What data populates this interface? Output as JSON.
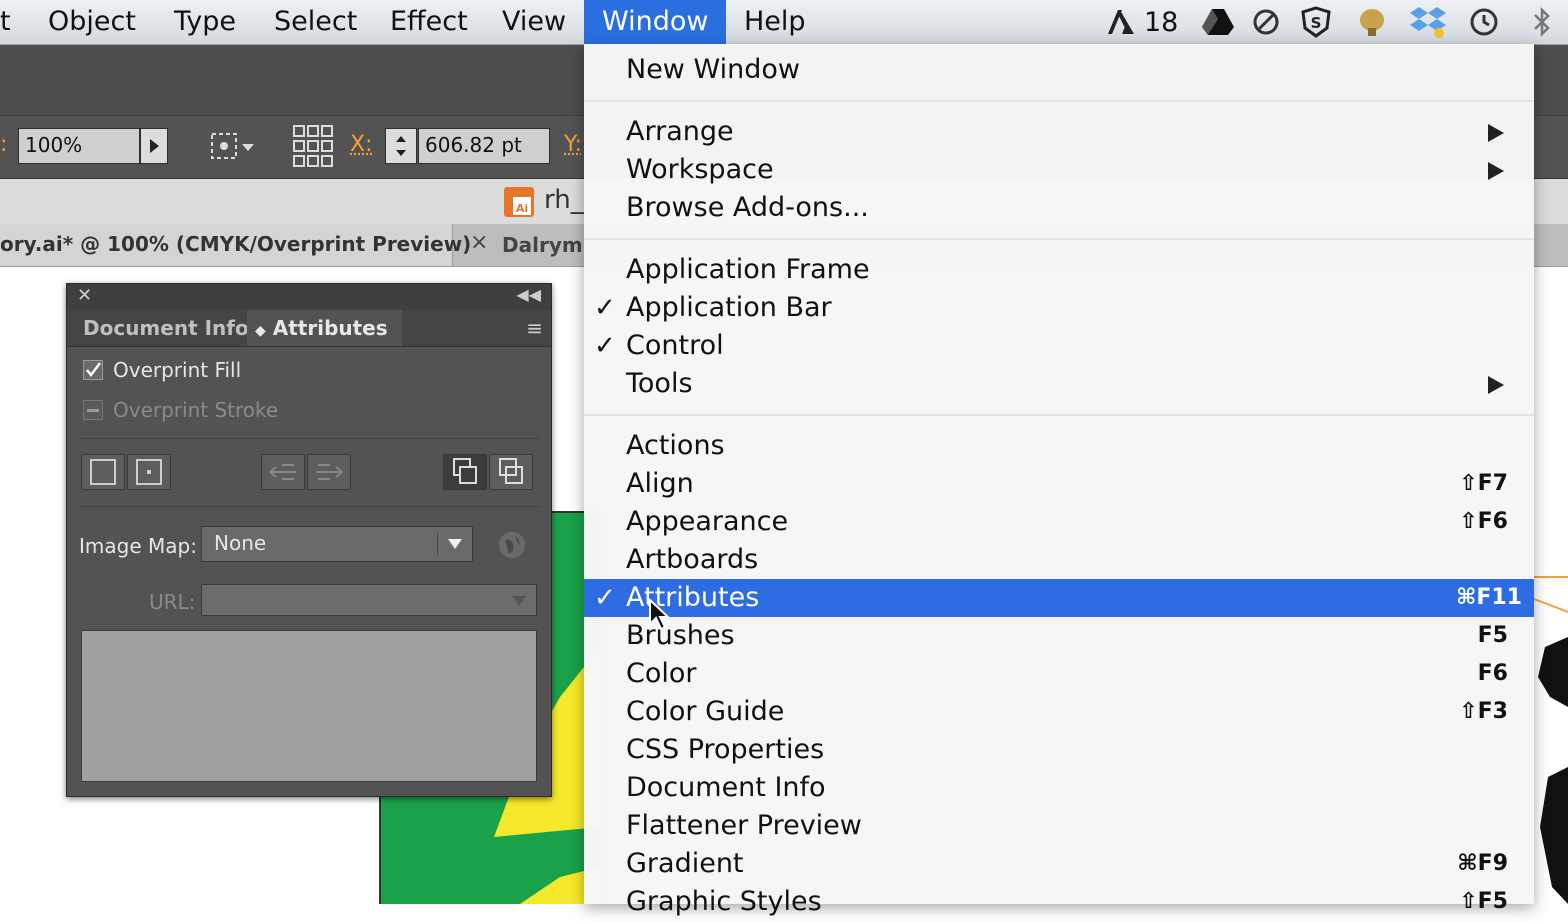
{
  "menubar": {
    "items": [
      "t",
      "Object",
      "Type",
      "Select",
      "Effect",
      "View",
      "Window",
      "Help"
    ],
    "active": "Window",
    "tray_badge_count": "18"
  },
  "control": {
    "zoom_value": "100%",
    "x_label": "X:",
    "x_value": "606.82 pt",
    "y_label": "Y:"
  },
  "filebar": {
    "filename_fragment": "rh_"
  },
  "tabs": {
    "doc_tab": "ory.ai* @ 100% (CMYK/Overprint Preview)",
    "second_tab": "Dalrymp"
  },
  "panel": {
    "tabs": [
      "Document Info",
      "Attributes"
    ],
    "selected_tab": "Attributes",
    "overprint_fill_label": "Overprint Fill",
    "overprint_fill_checked": true,
    "overprint_stroke_label": "Overprint Stroke",
    "image_map_label": "Image Map:",
    "image_map_value": "None",
    "url_label": "URL:",
    "url_value": ""
  },
  "window_menu": {
    "items": [
      {
        "label": "New Window",
        "checked": false,
        "shortcut": "",
        "submenu": false
      },
      {
        "label": "Arrange",
        "checked": false,
        "shortcut": "",
        "submenu": true
      },
      {
        "label": "Workspace",
        "checked": false,
        "shortcut": "",
        "submenu": true
      },
      {
        "label": "Browse Add-ons...",
        "checked": false,
        "shortcut": "",
        "submenu": false
      },
      {
        "label": "Application Frame",
        "checked": false,
        "shortcut": "",
        "submenu": false
      },
      {
        "label": "Application Bar",
        "checked": true,
        "shortcut": "",
        "submenu": false
      },
      {
        "label": "Control",
        "checked": true,
        "shortcut": "",
        "submenu": false
      },
      {
        "label": "Tools",
        "checked": false,
        "shortcut": "",
        "submenu": true
      },
      {
        "label": "Actions",
        "checked": false,
        "shortcut": "",
        "submenu": false
      },
      {
        "label": "Align",
        "checked": false,
        "shortcut": "⇧F7",
        "submenu": false
      },
      {
        "label": "Appearance",
        "checked": false,
        "shortcut": "⇧F6",
        "submenu": false
      },
      {
        "label": "Artboards",
        "checked": false,
        "shortcut": "",
        "submenu": false
      },
      {
        "label": "Attributes",
        "checked": true,
        "shortcut": "⌘F11",
        "submenu": false,
        "highlighted": true
      },
      {
        "label": "Brushes",
        "checked": false,
        "shortcut": "F5",
        "submenu": false
      },
      {
        "label": "Color",
        "checked": false,
        "shortcut": "F6",
        "submenu": false
      },
      {
        "label": "Color Guide",
        "checked": false,
        "shortcut": "⇧F3",
        "submenu": false
      },
      {
        "label": "CSS Properties",
        "checked": false,
        "shortcut": "",
        "submenu": false
      },
      {
        "label": "Document Info",
        "checked": false,
        "shortcut": "",
        "submenu": false
      },
      {
        "label": "Flattener Preview",
        "checked": false,
        "shortcut": "",
        "submenu": false
      },
      {
        "label": "Gradient",
        "checked": false,
        "shortcut": "⌘F9",
        "submenu": false
      },
      {
        "label": "Graphic Styles",
        "checked": false,
        "shortcut": "⇧F5",
        "submenu": false
      }
    ]
  },
  "colors": {
    "menu_highlight": "#2d6ce2",
    "control_label": "#f2a13b",
    "artwork_green": "#1aa24a",
    "artwork_yellow": "#f6e82a"
  }
}
